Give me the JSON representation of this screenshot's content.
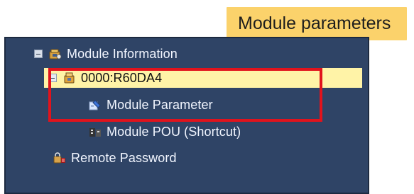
{
  "callout": {
    "text": "Module parameters"
  },
  "tree": {
    "items": [
      {
        "label": "Module Information",
        "icon": "module-information-icon"
      },
      {
        "label": "0000:R60DA4",
        "icon": "module-device-icon"
      },
      {
        "label": "Module Parameter",
        "icon": "module-parameter-icon"
      },
      {
        "label": "Module POU (Shortcut)",
        "icon": "module-pou-icon"
      },
      {
        "label": "Remote Password",
        "icon": "remote-password-icon"
      }
    ]
  },
  "colors": {
    "tree_background": "#2f4466",
    "selected_row": "#fff3a7",
    "highlight_frame": "#e1131c",
    "callout_background": "#fbd26b"
  }
}
